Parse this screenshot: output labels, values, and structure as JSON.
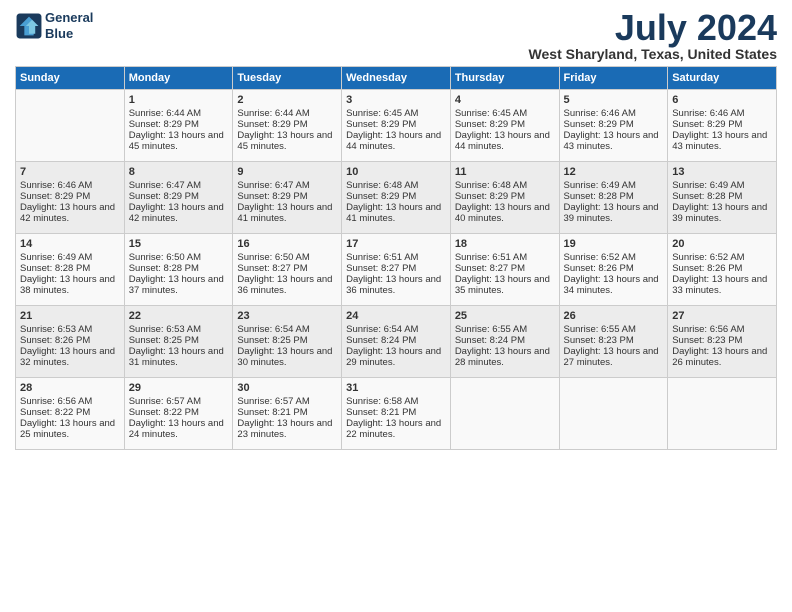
{
  "logo": {
    "line1": "General",
    "line2": "Blue"
  },
  "title": "July 2024",
  "location": "West Sharyland, Texas, United States",
  "days_of_week": [
    "Sunday",
    "Monday",
    "Tuesday",
    "Wednesday",
    "Thursday",
    "Friday",
    "Saturday"
  ],
  "weeks": [
    [
      {
        "day": "",
        "sunrise": "",
        "sunset": "",
        "daylight": ""
      },
      {
        "day": "1",
        "sunrise": "Sunrise: 6:44 AM",
        "sunset": "Sunset: 8:29 PM",
        "daylight": "Daylight: 13 hours and 45 minutes."
      },
      {
        "day": "2",
        "sunrise": "Sunrise: 6:44 AM",
        "sunset": "Sunset: 8:29 PM",
        "daylight": "Daylight: 13 hours and 45 minutes."
      },
      {
        "day": "3",
        "sunrise": "Sunrise: 6:45 AM",
        "sunset": "Sunset: 8:29 PM",
        "daylight": "Daylight: 13 hours and 44 minutes."
      },
      {
        "day": "4",
        "sunrise": "Sunrise: 6:45 AM",
        "sunset": "Sunset: 8:29 PM",
        "daylight": "Daylight: 13 hours and 44 minutes."
      },
      {
        "day": "5",
        "sunrise": "Sunrise: 6:46 AM",
        "sunset": "Sunset: 8:29 PM",
        "daylight": "Daylight: 13 hours and 43 minutes."
      },
      {
        "day": "6",
        "sunrise": "Sunrise: 6:46 AM",
        "sunset": "Sunset: 8:29 PM",
        "daylight": "Daylight: 13 hours and 43 minutes."
      }
    ],
    [
      {
        "day": "7",
        "sunrise": "Sunrise: 6:46 AM",
        "sunset": "Sunset: 8:29 PM",
        "daylight": "Daylight: 13 hours and 42 minutes."
      },
      {
        "day": "8",
        "sunrise": "Sunrise: 6:47 AM",
        "sunset": "Sunset: 8:29 PM",
        "daylight": "Daylight: 13 hours and 42 minutes."
      },
      {
        "day": "9",
        "sunrise": "Sunrise: 6:47 AM",
        "sunset": "Sunset: 8:29 PM",
        "daylight": "Daylight: 13 hours and 41 minutes."
      },
      {
        "day": "10",
        "sunrise": "Sunrise: 6:48 AM",
        "sunset": "Sunset: 8:29 PM",
        "daylight": "Daylight: 13 hours and 41 minutes."
      },
      {
        "day": "11",
        "sunrise": "Sunrise: 6:48 AM",
        "sunset": "Sunset: 8:29 PM",
        "daylight": "Daylight: 13 hours and 40 minutes."
      },
      {
        "day": "12",
        "sunrise": "Sunrise: 6:49 AM",
        "sunset": "Sunset: 8:28 PM",
        "daylight": "Daylight: 13 hours and 39 minutes."
      },
      {
        "day": "13",
        "sunrise": "Sunrise: 6:49 AM",
        "sunset": "Sunset: 8:28 PM",
        "daylight": "Daylight: 13 hours and 39 minutes."
      }
    ],
    [
      {
        "day": "14",
        "sunrise": "Sunrise: 6:49 AM",
        "sunset": "Sunset: 8:28 PM",
        "daylight": "Daylight: 13 hours and 38 minutes."
      },
      {
        "day": "15",
        "sunrise": "Sunrise: 6:50 AM",
        "sunset": "Sunset: 8:28 PM",
        "daylight": "Daylight: 13 hours and 37 minutes."
      },
      {
        "day": "16",
        "sunrise": "Sunrise: 6:50 AM",
        "sunset": "Sunset: 8:27 PM",
        "daylight": "Daylight: 13 hours and 36 minutes."
      },
      {
        "day": "17",
        "sunrise": "Sunrise: 6:51 AM",
        "sunset": "Sunset: 8:27 PM",
        "daylight": "Daylight: 13 hours and 36 minutes."
      },
      {
        "day": "18",
        "sunrise": "Sunrise: 6:51 AM",
        "sunset": "Sunset: 8:27 PM",
        "daylight": "Daylight: 13 hours and 35 minutes."
      },
      {
        "day": "19",
        "sunrise": "Sunrise: 6:52 AM",
        "sunset": "Sunset: 8:26 PM",
        "daylight": "Daylight: 13 hours and 34 minutes."
      },
      {
        "day": "20",
        "sunrise": "Sunrise: 6:52 AM",
        "sunset": "Sunset: 8:26 PM",
        "daylight": "Daylight: 13 hours and 33 minutes."
      }
    ],
    [
      {
        "day": "21",
        "sunrise": "Sunrise: 6:53 AM",
        "sunset": "Sunset: 8:26 PM",
        "daylight": "Daylight: 13 hours and 32 minutes."
      },
      {
        "day": "22",
        "sunrise": "Sunrise: 6:53 AM",
        "sunset": "Sunset: 8:25 PM",
        "daylight": "Daylight: 13 hours and 31 minutes."
      },
      {
        "day": "23",
        "sunrise": "Sunrise: 6:54 AM",
        "sunset": "Sunset: 8:25 PM",
        "daylight": "Daylight: 13 hours and 30 minutes."
      },
      {
        "day": "24",
        "sunrise": "Sunrise: 6:54 AM",
        "sunset": "Sunset: 8:24 PM",
        "daylight": "Daylight: 13 hours and 29 minutes."
      },
      {
        "day": "25",
        "sunrise": "Sunrise: 6:55 AM",
        "sunset": "Sunset: 8:24 PM",
        "daylight": "Daylight: 13 hours and 28 minutes."
      },
      {
        "day": "26",
        "sunrise": "Sunrise: 6:55 AM",
        "sunset": "Sunset: 8:23 PM",
        "daylight": "Daylight: 13 hours and 27 minutes."
      },
      {
        "day": "27",
        "sunrise": "Sunrise: 6:56 AM",
        "sunset": "Sunset: 8:23 PM",
        "daylight": "Daylight: 13 hours and 26 minutes."
      }
    ],
    [
      {
        "day": "28",
        "sunrise": "Sunrise: 6:56 AM",
        "sunset": "Sunset: 8:22 PM",
        "daylight": "Daylight: 13 hours and 25 minutes."
      },
      {
        "day": "29",
        "sunrise": "Sunrise: 6:57 AM",
        "sunset": "Sunset: 8:22 PM",
        "daylight": "Daylight: 13 hours and 24 minutes."
      },
      {
        "day": "30",
        "sunrise": "Sunrise: 6:57 AM",
        "sunset": "Sunset: 8:21 PM",
        "daylight": "Daylight: 13 hours and 23 minutes."
      },
      {
        "day": "31",
        "sunrise": "Sunrise: 6:58 AM",
        "sunset": "Sunset: 8:21 PM",
        "daylight": "Daylight: 13 hours and 22 minutes."
      },
      {
        "day": "",
        "sunrise": "",
        "sunset": "",
        "daylight": ""
      },
      {
        "day": "",
        "sunrise": "",
        "sunset": "",
        "daylight": ""
      },
      {
        "day": "",
        "sunrise": "",
        "sunset": "",
        "daylight": ""
      }
    ]
  ]
}
